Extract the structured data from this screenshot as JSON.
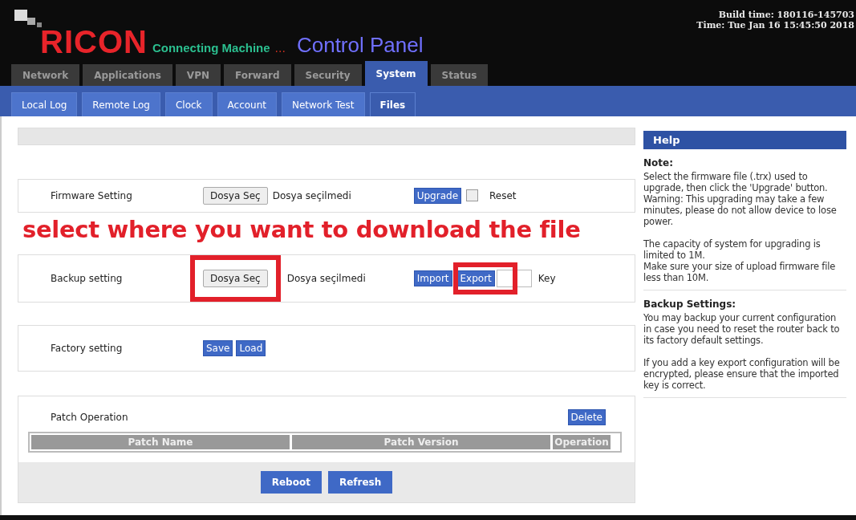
{
  "header": {
    "brand": "RICON",
    "tagline": "Connecting Machine",
    "ellipsis": "...",
    "title": "Control Panel",
    "build_time": "Build time: 180116-145703",
    "time": "Time: Tue Jan 16 15:45:50 2018"
  },
  "tabs": [
    {
      "label": "Network",
      "selected": false
    },
    {
      "label": "Applications",
      "selected": false
    },
    {
      "label": "VPN",
      "selected": false
    },
    {
      "label": "Forward",
      "selected": false
    },
    {
      "label": "Security",
      "selected": false
    },
    {
      "label": "System",
      "selected": true
    },
    {
      "label": "Status",
      "selected": false
    }
  ],
  "subtabs": [
    {
      "label": "Local Log",
      "selected": false
    },
    {
      "label": "Remote Log",
      "selected": false
    },
    {
      "label": "Clock",
      "selected": false
    },
    {
      "label": "Account",
      "selected": false
    },
    {
      "label": "Network Test",
      "selected": false
    },
    {
      "label": "Files",
      "selected": true
    }
  ],
  "firmware": {
    "label": "Firmware Setting",
    "file_button": "Dosya Seç",
    "file_status": "Dosya seçilmedi",
    "upgrade": "Upgrade",
    "reset": {
      "label": "Reset",
      "checked": false
    }
  },
  "annotation": "select where you want to download the file",
  "backup": {
    "label": "Backup setting",
    "file_button": {
      "label": "Dosya Seç",
      "highlighted": true
    },
    "file_status": "Dosya seçilmedi",
    "import": "Import",
    "export": {
      "label": "Export",
      "highlighted": true
    },
    "key_label": "Key"
  },
  "factory": {
    "label": "Factory setting",
    "buttons": [
      "Save",
      "Load"
    ]
  },
  "patch": {
    "label": "Patch Operation",
    "delete": "Delete",
    "columns": [
      "Patch Name",
      "Patch Version",
      "Operation"
    ]
  },
  "footer_buttons": [
    "Reboot",
    "Refresh"
  ],
  "help": {
    "title": "Help",
    "sections": [
      {
        "heading": "Note:",
        "blocks": [
          [
            "Select the firmware file (.trx) used to upgrade, then click the 'Upgrade' button.",
            "Warning: This upgrading may take a few minutes, please do not allow device to lose power."
          ],
          [
            "The capacity of system for upgrading is limited to 1M.",
            "Make sure your size of upload firmware file less than 10M."
          ]
        ]
      },
      {
        "heading": "Backup Settings:",
        "blocks": [
          [
            "You may backup your current configuration in case you need to reset the router back to its factory default settings."
          ],
          [
            "If you add a key export configuration will be encrypted, please ensure that the imported key is correct."
          ]
        ]
      }
    ]
  }
}
